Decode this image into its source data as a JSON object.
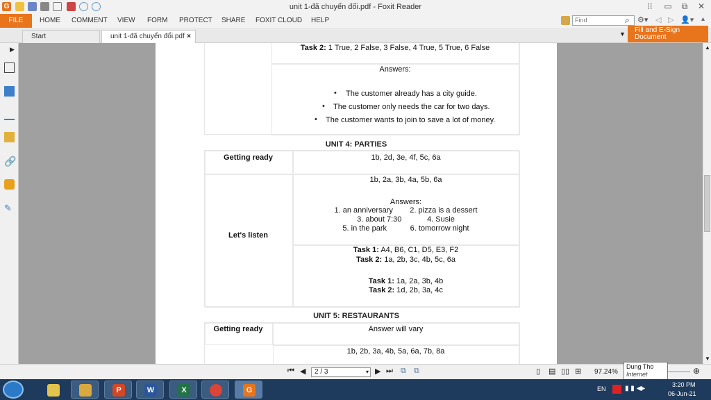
{
  "window": {
    "title": "unit 1-đã chuyển đổi.pdf - Foxit Reader"
  },
  "ribbon": {
    "file": "FILE",
    "menu": [
      "HOME",
      "COMMENT",
      "VIEW",
      "FORM",
      "PROTECT",
      "SHARE",
      "FOXIT CLOUD",
      "HELP"
    ],
    "find_placeholder": "Find"
  },
  "tabs": [
    {
      "label": "Start"
    },
    {
      "label": "unit 1-đã chuyển đổi.pdf"
    }
  ],
  "fill_sign": {
    "line1": "Fill and E-Sign",
    "line2": "Document"
  },
  "document": {
    "top_table": {
      "task2": {
        "label": "Task 2:",
        "value": " 1 True, 2 False, 3 False, 4 True, 5 True, 6 False"
      },
      "answers_label": "Answers:",
      "bullets": [
        "The customer already has a city guide.",
        "The customer only needs the car for two days.",
        "The customer wants to join to save a lot of money."
      ]
    },
    "unit4": {
      "heading": "UNIT 4: PARTIES",
      "getting_ready_label": "Getting ready",
      "getting_ready_answer": "1b, 2d, 3e, 4f, 5c, 6a",
      "lets_listen_label": "Let's listen",
      "listen_line1": "1b, 2a, 3b, 4a, 5b, 6a",
      "answers_label": "Answers:",
      "answers_rows": [
        "1. an anniversary        2. pizza is a dessert",
        "3. about 7:30            4. Susie",
        "5. in the park           6. tomorrow night"
      ],
      "task1a": {
        "label": "Task 1:",
        "value": " A4, B6, C1, D5, E3, F2"
      },
      "task2a": {
        "label": "Task 2:",
        "value": " 1a, 2b, 3c, 4b, 5c, 6a"
      },
      "task1b": {
        "label": "Task 1:",
        "value": " 1a, 2a, 3b, 4b"
      },
      "task2b": {
        "label": "Task 2:",
        "value": " 1d, 2b, 3a, 4c"
      }
    },
    "unit5": {
      "heading": "UNIT 5: RESTAURANTS",
      "getting_ready_label": "Getting ready",
      "getting_ready_answer": "Answer will vary",
      "next_line": "1b, 2b, 3a, 4b, 5a, 6a, 7b, 8a"
    }
  },
  "statusbar": {
    "page_indicator": "2 / 3",
    "zoom": "97.24%"
  },
  "tooltip": {
    "line1": "Dung Tho",
    "line2": "Internet access"
  },
  "tray": {
    "lang": "EN",
    "time": "3:20 PM",
    "date": "06-Jun-21"
  },
  "colors": {
    "accent": "#e8741c",
    "taskbar": "#1e3a5c"
  }
}
